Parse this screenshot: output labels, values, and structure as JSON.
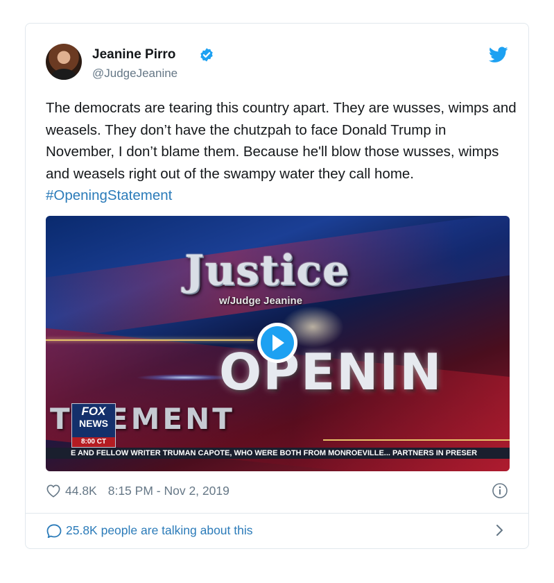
{
  "tweet": {
    "author": {
      "name": "Jeanine Pirro",
      "handle": "@JudgeJeanine",
      "verified": true
    },
    "text": "The democrats are tearing this country apart. They are wusses, wimps and weasels. They don’t have the chutzpah to face Donald Trump in November, I don’t blame them. Because he'll blow those wusses, wimps and weasels right out of the swampy water they call home.",
    "hashtag": "#OpeningStatement",
    "media": {
      "title": "Justice",
      "subtitle": "w/Judge Jeanine",
      "overlay_word": "OPENIN",
      "overlay_word_2": "T  TEMENT",
      "network_logo_top": "FOX",
      "network_logo_bottom": "NEWS",
      "time_badge": "8:00 CT",
      "ticker": "E AND FELLOW WRITER TRUMAN CAPOTE, WHO WERE BOTH FROM MONROEVILLE...  PARTNERS IN PRESER"
    },
    "likes": "44.8K",
    "timestamp": "8:15 PM - Nov 2, 2019",
    "talking_about": "25.8K people are talking about this"
  },
  "colors": {
    "link": "#2b7bb9",
    "twitter_blue": "#1da1f2",
    "muted": "#657786",
    "text": "#14171a",
    "border": "#e1e8ed"
  },
  "icons": [
    "avatar",
    "verified-icon",
    "twitter-bird-icon",
    "play-icon",
    "heart-icon",
    "info-icon",
    "comment-icon",
    "chevron-right-icon"
  ]
}
